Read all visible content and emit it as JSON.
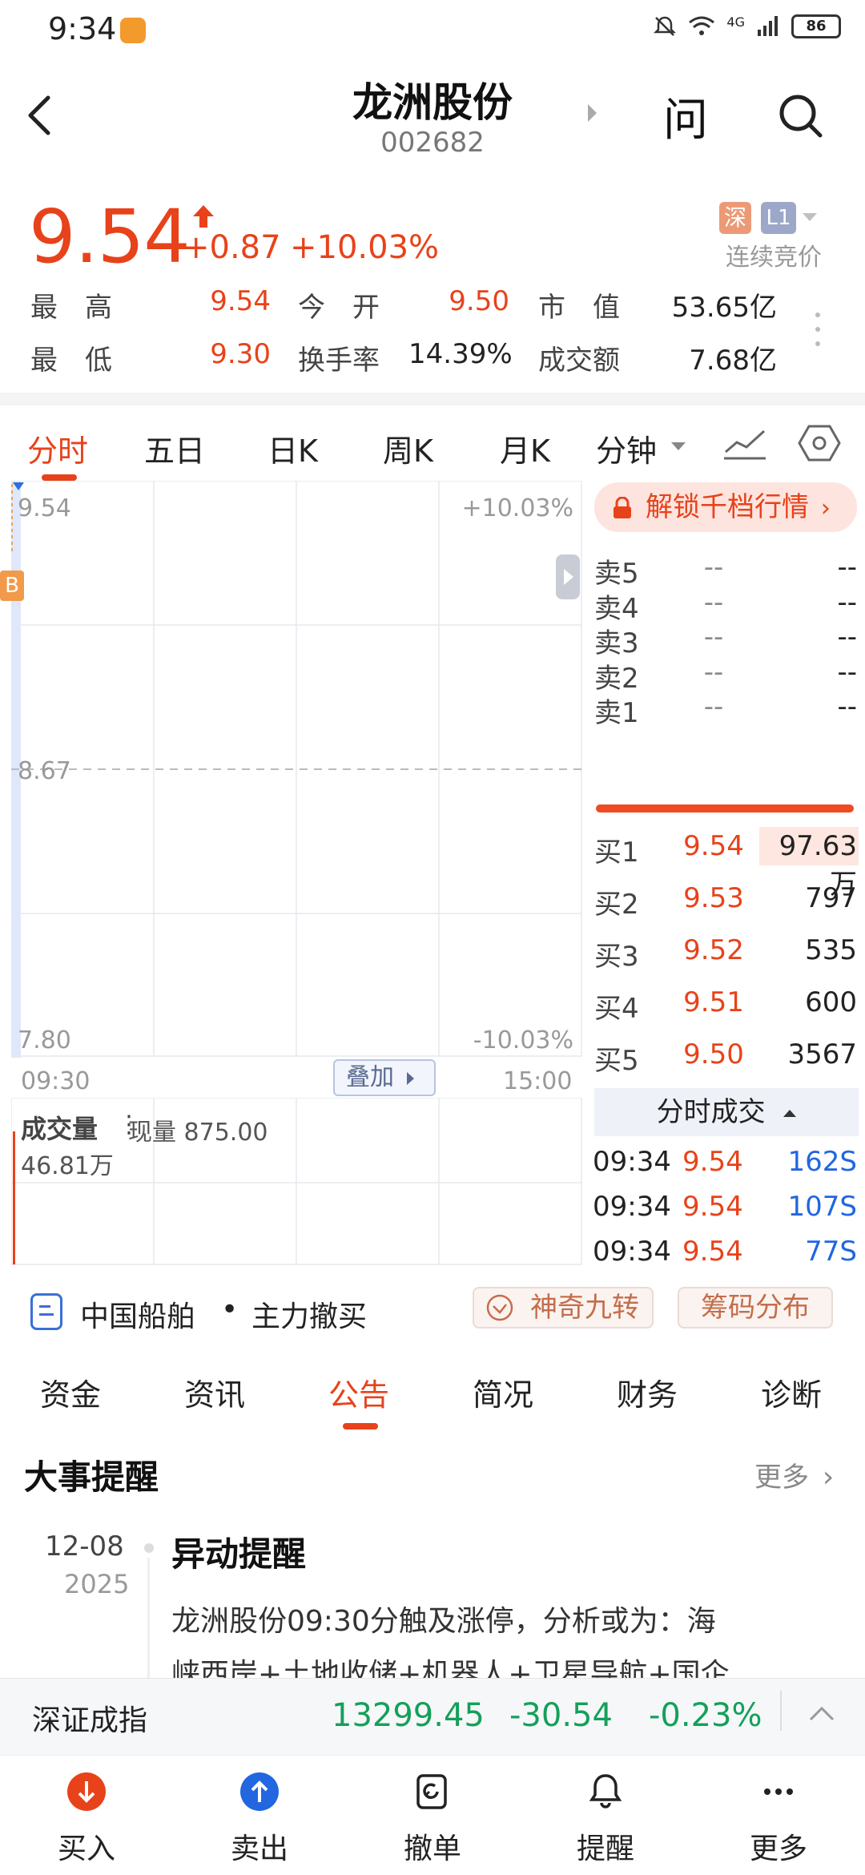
{
  "status_bar": {
    "time": "9:34",
    "network": "4G",
    "battery": "86"
  },
  "header": {
    "title": "龙洲股份",
    "code": "002682",
    "ask_label": "问"
  },
  "quote": {
    "price": "9.54",
    "change": "+0.87",
    "change_pct": "+10.03%",
    "exchange_badge": "深",
    "level_badge": "L1",
    "auction_status": "连续竞价"
  },
  "stats": [
    {
      "label": "最　高",
      "value": "9.54",
      "color": "red"
    },
    {
      "label": "今　开",
      "value": "9.50",
      "color": "red"
    },
    {
      "label": "市　值",
      "value": "53.65亿",
      "color": "black"
    },
    {
      "label": "最　低",
      "value": "9.30",
      "color": "red"
    },
    {
      "label": "换手率",
      "value": "14.39%",
      "color": "black"
    },
    {
      "label": "成交额",
      "value": "7.68亿",
      "color": "black"
    }
  ],
  "chart_tabs": [
    "分时",
    "五日",
    "日K",
    "周K",
    "月K",
    "分钟"
  ],
  "chart_tabs_active": "分时",
  "chart_data": {
    "type": "line",
    "y_ticks_left": [
      "9.54",
      "8.67",
      "7.80"
    ],
    "y_ticks_right": [
      "+10.03%",
      "-10.03%"
    ],
    "x_ticks": [
      "09:30",
      "15:00"
    ],
    "ylim": [
      7.8,
      9.54
    ],
    "prev_close": 8.67,
    "overlay_button": "叠加",
    "marker": "B",
    "volume": {
      "title": "成交量",
      "current_label": "现量 875.00",
      "max_label": "46.81万"
    }
  },
  "order_book": {
    "unlock_label": "解锁千档行情",
    "sells": [
      {
        "label": "卖5",
        "price": "--",
        "vol": "--"
      },
      {
        "label": "卖4",
        "price": "--",
        "vol": "--"
      },
      {
        "label": "卖3",
        "price": "--",
        "vol": "--"
      },
      {
        "label": "卖2",
        "price": "--",
        "vol": "--"
      },
      {
        "label": "卖1",
        "price": "--",
        "vol": "--"
      }
    ],
    "buys": [
      {
        "label": "买1",
        "price": "9.54",
        "vol": "97.63万"
      },
      {
        "label": "买2",
        "price": "9.53",
        "vol": "797"
      },
      {
        "label": "买3",
        "price": "9.52",
        "vol": "535"
      },
      {
        "label": "买4",
        "price": "9.51",
        "vol": "600"
      },
      {
        "label": "买5",
        "price": "9.50",
        "vol": "3567"
      }
    ],
    "trades_title": "分时成交",
    "trades": [
      {
        "time": "09:34",
        "price": "9.54",
        "vol": "162S"
      },
      {
        "time": "09:34",
        "price": "9.54",
        "vol": "107S"
      },
      {
        "time": "09:34",
        "price": "9.54",
        "vol": "77S"
      }
    ]
  },
  "info_row": {
    "text1": "中国船舶",
    "text2": "主力撤买",
    "pill1": "神奇九转",
    "pill2": "筹码分布"
  },
  "detail_tabs": [
    "资金",
    "资讯",
    "公告",
    "简况",
    "财务",
    "诊断"
  ],
  "detail_tabs_active": "公告",
  "events": {
    "title": "大事提醒",
    "more": "更多",
    "item": {
      "date": "12-08",
      "year": "2025",
      "headline": "异动提醒",
      "body_line1": "龙洲股份09:30分触及涨停，分析或为：海",
      "body_line2": "峡西岸+土地收储+机器人+卫星导航+国企"
    }
  },
  "index_bar": {
    "name": "深证成指",
    "value": "13299.45",
    "change": "-30.54",
    "change_pct": "-0.23%"
  },
  "nav": [
    {
      "label": "买入",
      "icon": "buy-icon"
    },
    {
      "label": "卖出",
      "icon": "sell-icon"
    },
    {
      "label": "撤单",
      "icon": "cancel-order-icon"
    },
    {
      "label": "提醒",
      "icon": "bell-icon"
    },
    {
      "label": "更多",
      "icon": "more-icon"
    }
  ],
  "colors": {
    "up": "#e8421a",
    "down": "#14a05a",
    "accent": "#e8421a",
    "buy": "#e8421a",
    "sell": "#2266e0"
  }
}
